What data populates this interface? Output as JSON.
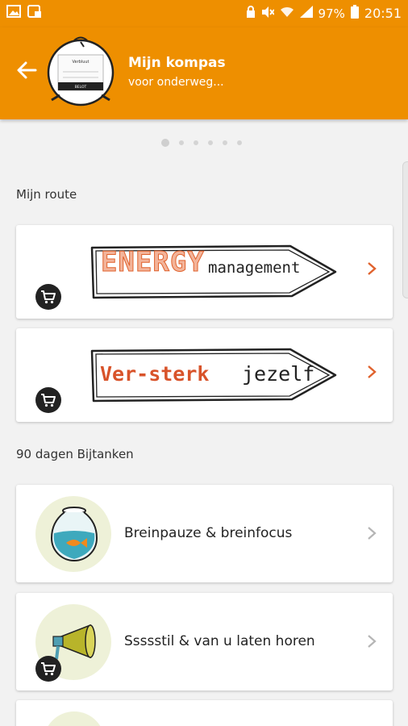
{
  "status_bar": {
    "battery": "97%",
    "time": "20:51"
  },
  "header": {
    "title": "Mijn kompas",
    "subtitle": "voor onderweg...",
    "avatar_caption": "Verbluut",
    "avatar_button": "BELOT"
  },
  "carousel": {
    "count": 6,
    "active": 0
  },
  "route": {
    "label": "Mijn route",
    "cards": [
      {
        "sign_part1": "ENERGY",
        "sign_part2": "management"
      },
      {
        "sign_part1": "Ver-sterk",
        "sign_part2": "jezelf"
      }
    ]
  },
  "bijtanken": {
    "label": "90 dagen Bijtanken",
    "items": [
      {
        "label": "Breinpauze & breinfocus"
      },
      {
        "label": "Ssssstil & van u laten horen"
      }
    ]
  },
  "colors": {
    "accent": "#ee8f00",
    "sign_orange": "#e0622d"
  },
  "icons": [
    "back-arrow-icon",
    "cart-icon",
    "chevron-right-icon",
    "fishbowl-icon",
    "megaphone-icon"
  ]
}
